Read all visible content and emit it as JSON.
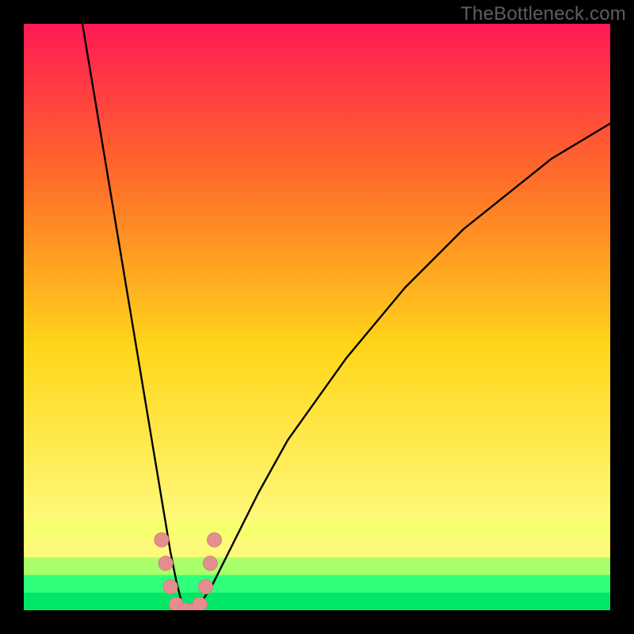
{
  "watermark": "TheBottleneck.com",
  "colors": {
    "bg_black": "#000000",
    "curve": "#000000",
    "marker_fill": "#e48f8f",
    "marker_stroke": "#d97c7c",
    "grad_top": "#ff1a55",
    "grad_mid1": "#ff6a2a",
    "grad_mid2": "#ffd61a",
    "grad_low": "#fff97a",
    "grad_base_yellow": "#f5ff70",
    "grad_green1": "#a8ff6a",
    "grad_green2": "#2fff7a",
    "grad_green3": "#00e765"
  },
  "chart_data": {
    "type": "line",
    "title": "",
    "xlabel": "",
    "ylabel": "",
    "xlim": [
      0,
      100
    ],
    "ylim": [
      0,
      100
    ],
    "series": [
      {
        "name": "bottleneck-curve",
        "x": [
          10,
          12,
          14,
          16,
          18,
          20,
          22,
          23,
          24,
          25,
          26,
          27,
          28,
          29,
          30,
          32,
          36,
          40,
          45,
          50,
          55,
          60,
          65,
          70,
          75,
          80,
          85,
          90,
          95,
          100
        ],
        "y": [
          100,
          88,
          76,
          64,
          52,
          40,
          28,
          22,
          16,
          10,
          5,
          1,
          0,
          0,
          1,
          4,
          12,
          20,
          29,
          36,
          43,
          49,
          55,
          60,
          65,
          69,
          73,
          77,
          80,
          83
        ]
      }
    ],
    "markers": [
      {
        "x": 23.5,
        "y": 12
      },
      {
        "x": 24.2,
        "y": 8
      },
      {
        "x": 25.0,
        "y": 4
      },
      {
        "x": 26.0,
        "y": 1
      },
      {
        "x": 27.5,
        "y": 0
      },
      {
        "x": 29.0,
        "y": 0
      },
      {
        "x": 30.0,
        "y": 1
      },
      {
        "x": 31.0,
        "y": 4
      },
      {
        "x": 31.8,
        "y": 8
      },
      {
        "x": 32.5,
        "y": 12
      }
    ],
    "gradient_bands": [
      {
        "y0": 100,
        "y1": 15,
        "type": "smooth",
        "from": "grad_top",
        "to": "grad_low"
      },
      {
        "y0": 15,
        "y1": 12,
        "color": "grad_base_yellow"
      },
      {
        "y0": 12,
        "y1": 9,
        "color": "grad_low"
      },
      {
        "y0": 9,
        "y1": 6,
        "color": "grad_green1"
      },
      {
        "y0": 6,
        "y1": 3,
        "color": "grad_green2"
      },
      {
        "y0": 3,
        "y1": 0,
        "color": "grad_green3"
      }
    ]
  }
}
